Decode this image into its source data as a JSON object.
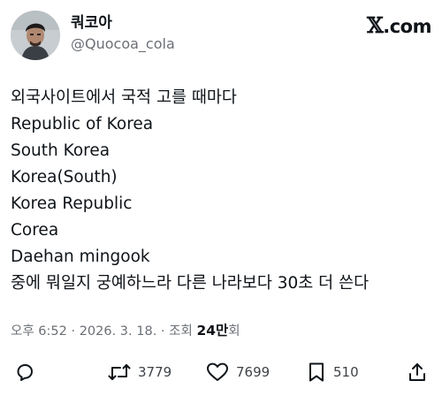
{
  "author": {
    "display_name": "쿼코아",
    "handle": "@Quocoa_cola"
  },
  "brand": {
    "x": "𝕏",
    "domain": ".com"
  },
  "tweet": {
    "lines": [
      "외국사이트에서 국적 고를 때마다",
      "Republic of Korea",
      "South Korea",
      "Korea(South)",
      "Korea Republic",
      "Corea",
      "Daehan mingook",
      "중에 뭐일지 궁예하느라 다른 나라보다 30초 더 쓴다"
    ]
  },
  "meta": {
    "time": "오후 6:52",
    "separator": " · ",
    "date": "2026. 3. 18.",
    "views_label": "조회 ",
    "views_count": "24만",
    "views_suffix": "회"
  },
  "actions": {
    "reply_icon": "reply-icon",
    "retweet_count": "3779",
    "like_count": "7699",
    "bookmark_count": "510",
    "share_icon": "share-icon"
  }
}
